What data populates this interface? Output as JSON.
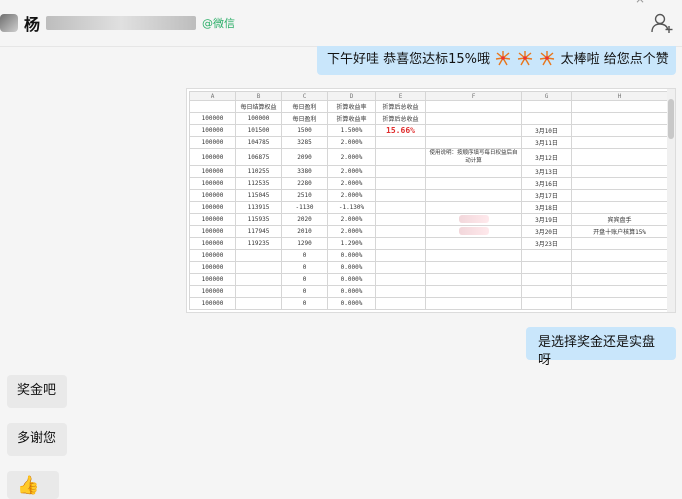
{
  "header": {
    "name_visible": "杨",
    "name_suffix": "升",
    "tag": "@微信",
    "close_glyph": "×"
  },
  "messages": [
    {
      "id": "m1",
      "side": "right",
      "text_before": "下午好哇  恭喜您达标15%哦",
      "emojis": [
        "fireworks",
        "fireworks",
        "fireworks"
      ],
      "text_after": "太棒啦 给您点个赞"
    },
    {
      "id": "m2",
      "side": "right",
      "text": "是选择奖金还是实盘呀"
    },
    {
      "id": "m3",
      "side": "left",
      "text": "奖金吧"
    },
    {
      "id": "m4",
      "side": "left",
      "text": "多谢您"
    },
    {
      "id": "m5",
      "side": "left",
      "text": "👍"
    }
  ],
  "sheet": {
    "columns": [
      "A",
      "B",
      "C",
      "D",
      "E",
      "F",
      "G",
      "H"
    ],
    "header_row": [
      "",
      "每日结算权益",
      "每日盈利",
      "折算收益率",
      "折算后总收益",
      "",
      "",
      ""
    ],
    "rows": [
      [
        "100000",
        "100000",
        "每日盈利",
        "折算收益率",
        "折算后总收益",
        "",
        "",
        ""
      ],
      [
        "100000",
        "101500",
        "1500",
        "1.500%",
        "15.66%",
        "",
        "3月10日",
        ""
      ],
      [
        "100000",
        "104785",
        "3285",
        "2.000%",
        "",
        "",
        "3月11日",
        ""
      ],
      [
        "100000",
        "106875",
        "2090",
        "2.000%",
        "",
        "使用说明：按顺序填写每日权益后自动计算",
        "3月12日",
        ""
      ],
      [
        "100000",
        "110255",
        "3380",
        "2.000%",
        "",
        "",
        "3月13日",
        ""
      ],
      [
        "100000",
        "112535",
        "2280",
        "2.000%",
        "",
        "",
        "3月16日",
        ""
      ],
      [
        "100000",
        "115045",
        "2510",
        "2.000%",
        "",
        "",
        "3月17日",
        ""
      ],
      [
        "100000",
        "113915",
        "-1130",
        "-1.130%",
        "",
        "",
        "3月18日",
        ""
      ],
      [
        "100000",
        "115935",
        "2020",
        "2.000%",
        "",
        "",
        "3月19日",
        "宾宾盘手"
      ],
      [
        "100000",
        "117945",
        "2010",
        "2.000%",
        "",
        "",
        "3月20日",
        "开盘十账户核算15%"
      ],
      [
        "100000",
        "119235",
        "1290",
        "1.290%",
        "",
        "",
        "3月23日",
        ""
      ],
      [
        "100000",
        "",
        "0",
        "0.000%",
        "",
        "",
        "",
        ""
      ],
      [
        "100000",
        "",
        "0",
        "0.000%",
        "",
        "",
        "",
        ""
      ],
      [
        "100000",
        "",
        "0",
        "0.000%",
        "",
        "",
        "",
        ""
      ],
      [
        "100000",
        "",
        "0",
        "0.000%",
        "",
        "",
        "",
        ""
      ],
      [
        "100000",
        "",
        "0",
        "0.000%",
        "",
        "",
        "",
        ""
      ]
    ],
    "highlight_value": "15.66%",
    "note": "使用说明：按顺序填写每日权益后自动计算"
  },
  "colors": {
    "right_bubble": "#c9e6fb",
    "left_bubble": "#e9e9e9",
    "wechat_green": "#2aae67",
    "highlight_red": "#e02d2d"
  }
}
